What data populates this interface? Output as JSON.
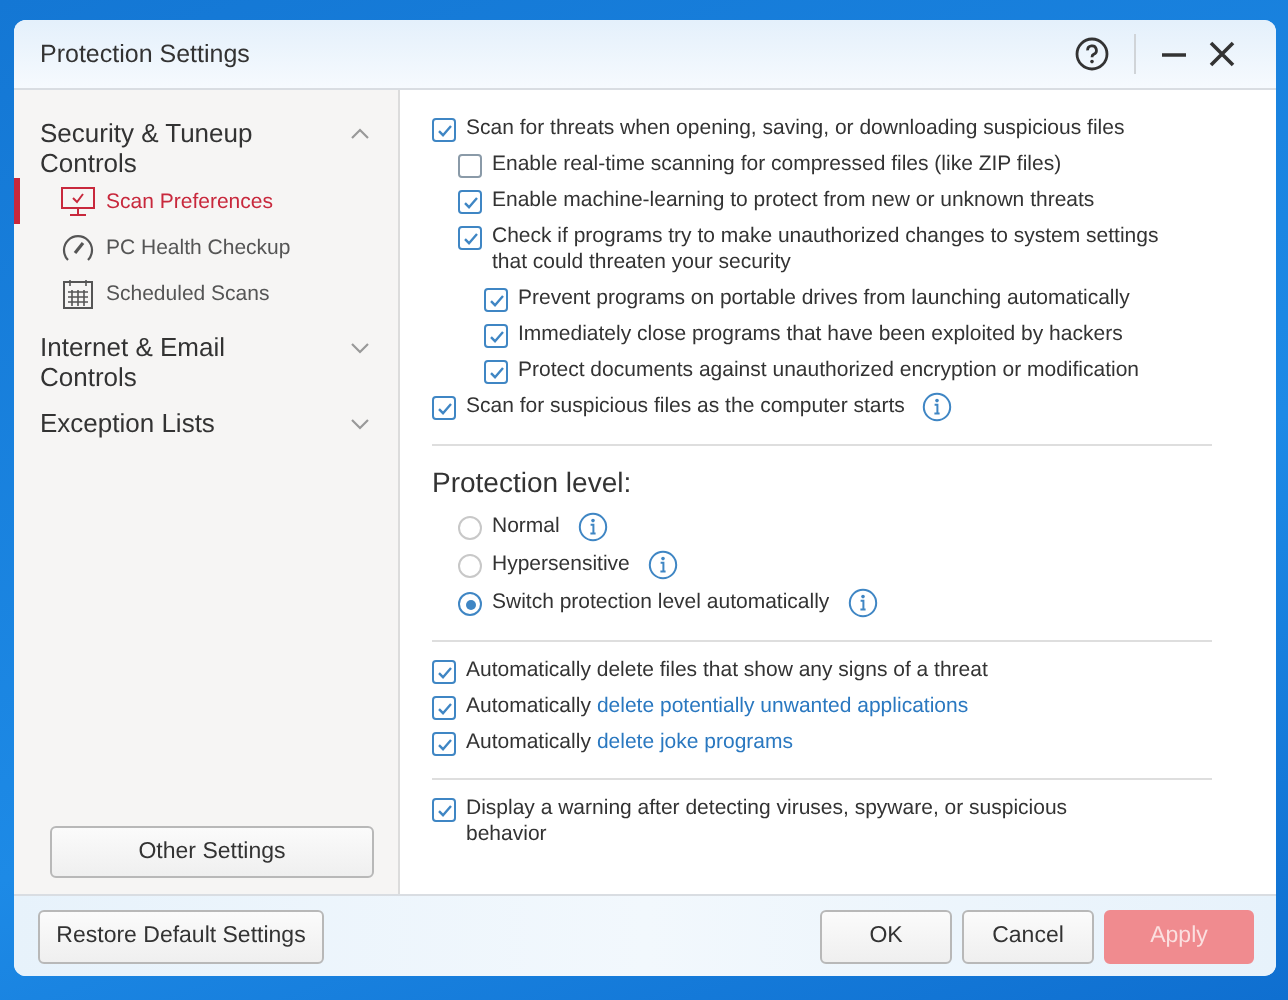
{
  "window": {
    "title": "Protection Settings"
  },
  "sidebar": {
    "groups": [
      {
        "label": "Security & Tuneup Controls",
        "expanded": true,
        "items": [
          {
            "label": "Scan Preferences",
            "kind": "monitor",
            "selected": true
          },
          {
            "label": "PC Health Checkup",
            "kind": "gauge",
            "selected": false
          },
          {
            "label": "Scheduled Scans",
            "kind": "calendar",
            "selected": false
          }
        ]
      },
      {
        "label": "Internet & Email Controls",
        "expanded": false
      },
      {
        "label": "Exception Lists",
        "expanded": false
      }
    ],
    "other_settings_button": "Other Settings"
  },
  "scan_options": [
    {
      "label": "Scan for threats when opening, saving, or downloading suspicious files",
      "checked": true,
      "children": [
        {
          "label": "Enable real-time scanning for compressed files (like ZIP files)",
          "checked": false
        },
        {
          "label": "Enable machine-learning to protect from new or unknown threats",
          "checked": true
        },
        {
          "label": "Check if programs try to make unauthorized changes to system settings that could threaten your security",
          "checked": true,
          "children": [
            {
              "label": "Prevent programs on portable drives from launching automatically",
              "checked": true
            },
            {
              "label": "Immediately close programs that have been exploited by hackers",
              "checked": true
            },
            {
              "label": "Protect documents against unauthorized encryption or modification",
              "checked": true
            }
          ]
        }
      ]
    },
    {
      "label": "Scan for suspicious files as the computer starts",
      "checked": true,
      "info": true
    }
  ],
  "protection_level": {
    "title": "Protection level:",
    "options": [
      {
        "label": "Normal",
        "selected": false,
        "info": true
      },
      {
        "label": "Hypersensitive",
        "selected": false,
        "info": true
      },
      {
        "label": "Switch protection level automatically",
        "selected": true,
        "info": true
      }
    ]
  },
  "deletion_options": [
    {
      "label": "Automatically delete files that show any signs of a threat",
      "checked": true
    },
    {
      "label": "Automatically",
      "link": "delete potentially unwanted applications",
      "checked": true
    },
    {
      "label": "Automatically",
      "link": "delete joke programs",
      "checked": true
    }
  ],
  "warning_options": [
    {
      "label": "Display a warning after detecting viruses, spyware, or suspicious behavior",
      "checked": true
    }
  ],
  "footer": {
    "restore_button": "Restore Default Settings",
    "ok_button": "OK",
    "cancel_button": "Cancel",
    "apply_button": {
      "label": "Apply",
      "disabled": true
    }
  }
}
